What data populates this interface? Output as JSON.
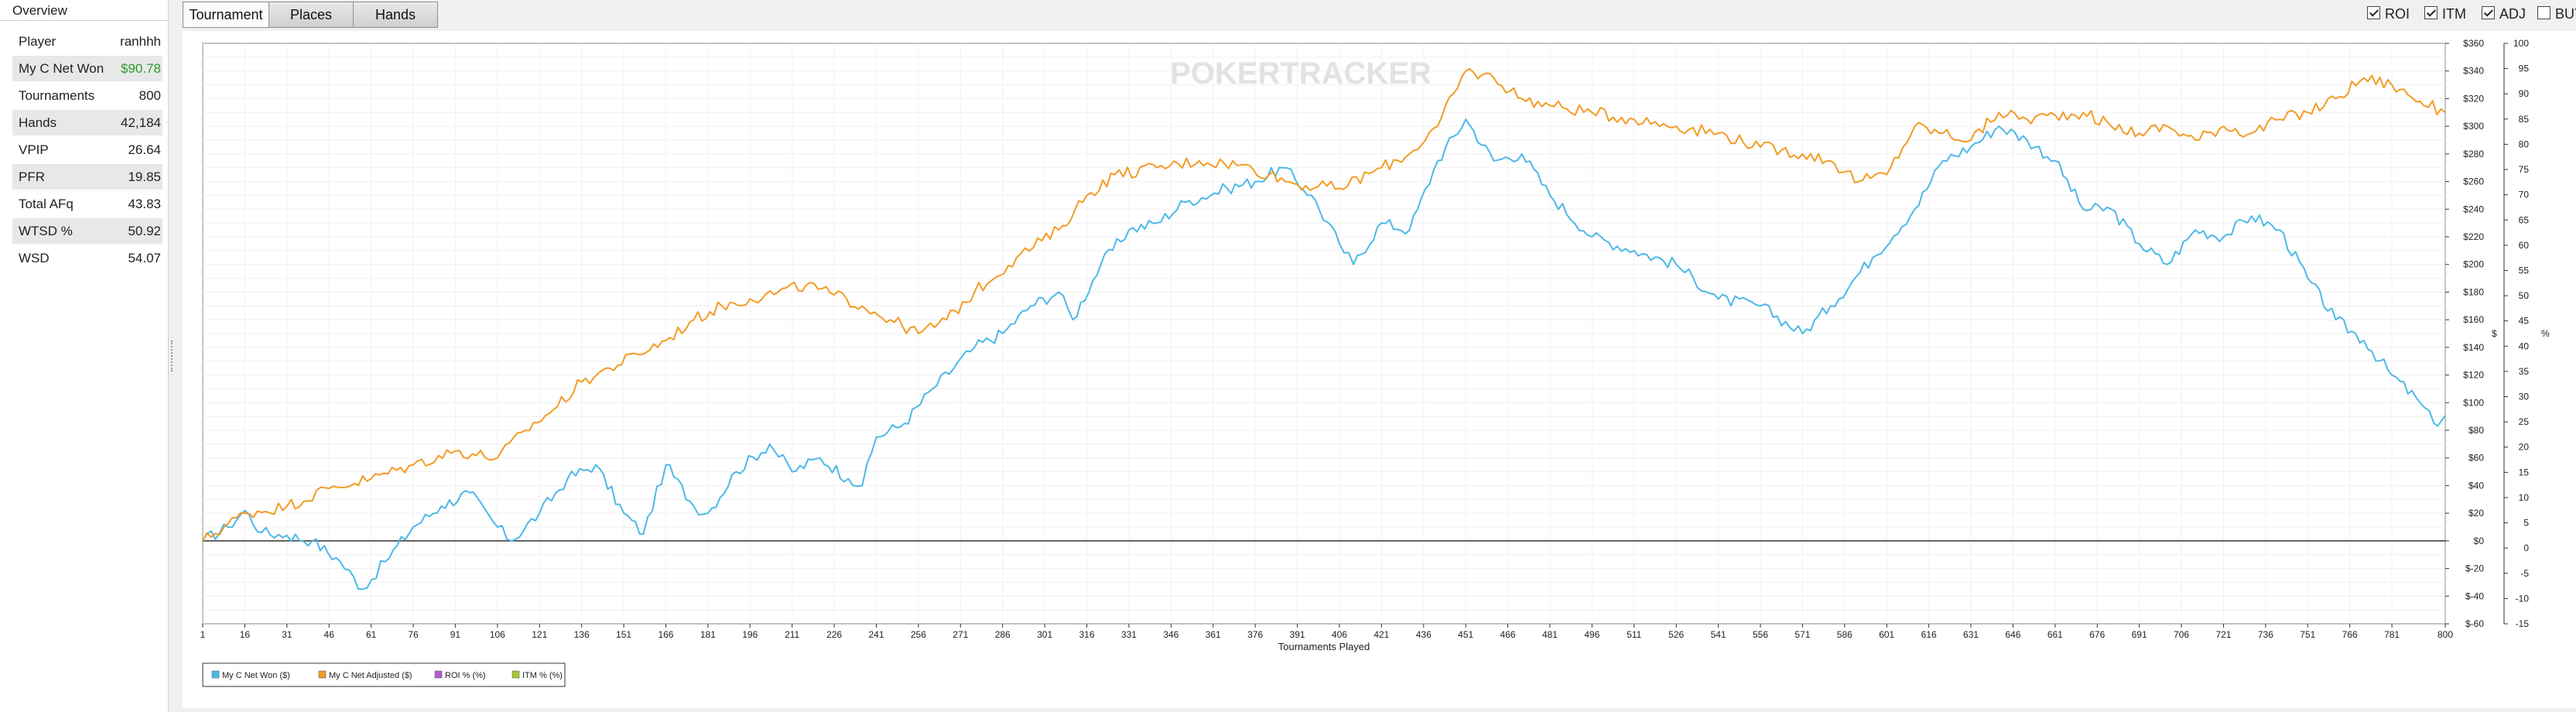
{
  "overview": {
    "title": "Overview",
    "stats": [
      {
        "label": "Player",
        "value": "ranhhh",
        "color": "#222222"
      },
      {
        "label": "My C Net Won",
        "value": "$90.78",
        "color": "#2e9a2e"
      },
      {
        "label": "Tournaments",
        "value": "800",
        "color": "#222222"
      },
      {
        "label": "Hands",
        "value": "42,184",
        "color": "#222222"
      },
      {
        "label": "VPIP",
        "value": "26.64",
        "color": "#222222"
      },
      {
        "label": "PFR",
        "value": "19.85",
        "color": "#222222"
      },
      {
        "label": "Total AFq",
        "value": "43.83",
        "color": "#222222"
      },
      {
        "label": "WTSD %",
        "value": "50.92",
        "color": "#222222"
      },
      {
        "label": "WSD",
        "value": "54.07",
        "color": "#222222"
      }
    ]
  },
  "tabs": [
    {
      "label": "Tournament",
      "active": true
    },
    {
      "label": "Places",
      "active": false
    },
    {
      "label": "Hands",
      "active": false
    }
  ],
  "toggles": [
    {
      "label": "ROI",
      "checked": true
    },
    {
      "label": "ITM",
      "checked": true
    },
    {
      "label": "ADJ",
      "checked": true
    },
    {
      "label": "BUY",
      "checked": false
    }
  ],
  "chart_data": {
    "type": "line",
    "watermark": "POKERTRACKER",
    "xlabel": "Tournaments Played",
    "ylabel": "$",
    "y2label": "%",
    "xlim": [
      1,
      800
    ],
    "ylim": [
      -60,
      360
    ],
    "y2lim": [
      -15,
      100
    ],
    "xticks": [
      1,
      16,
      31,
      46,
      61,
      76,
      91,
      106,
      121,
      136,
      151,
      166,
      181,
      196,
      211,
      226,
      241,
      256,
      271,
      286,
      301,
      316,
      331,
      346,
      361,
      376,
      391,
      406,
      421,
      436,
      451,
      466,
      481,
      496,
      511,
      526,
      541,
      556,
      571,
      586,
      601,
      616,
      631,
      646,
      661,
      676,
      691,
      706,
      721,
      736,
      751,
      766,
      781,
      800
    ],
    "yticks": [
      -60,
      -40,
      -20,
      0,
      20,
      40,
      60,
      80,
      100,
      120,
      140,
      160,
      180,
      200,
      220,
      240,
      260,
      280,
      300,
      320,
      340,
      360
    ],
    "ytick_labels": [
      "$-60",
      "$-40",
      "$-20",
      "$0",
      "$20",
      "$40",
      "$60",
      "$80",
      "$100",
      "$120",
      "$140",
      "$160",
      "$180",
      "$200",
      "$220",
      "$240",
      "$260",
      "$280",
      "$300",
      "$320",
      "$340",
      "$360"
    ],
    "y2ticks": [
      -15,
      -10,
      -5,
      0,
      5,
      10,
      15,
      20,
      25,
      30,
      35,
      40,
      45,
      50,
      55,
      60,
      65,
      70,
      75,
      80,
      85,
      90,
      95,
      100
    ],
    "grid": true,
    "legend_position": "bottom-left",
    "series": [
      {
        "name": "My C Net Won ($)",
        "color": "#4db8e8",
        "points": [
          [
            1,
            0
          ],
          [
            10,
            10
          ],
          [
            16,
            22
          ],
          [
            22,
            6
          ],
          [
            31,
            4
          ],
          [
            40,
            0
          ],
          [
            50,
            -15
          ],
          [
            58,
            -35
          ],
          [
            66,
            -15
          ],
          [
            76,
            10
          ],
          [
            86,
            25
          ],
          [
            96,
            35
          ],
          [
            106,
            10
          ],
          [
            111,
            0
          ],
          [
            121,
            20
          ],
          [
            131,
            45
          ],
          [
            141,
            55
          ],
          [
            151,
            20
          ],
          [
            158,
            5
          ],
          [
            166,
            55
          ],
          [
            176,
            25
          ],
          [
            181,
            20
          ],
          [
            191,
            50
          ],
          [
            203,
            70
          ],
          [
            211,
            50
          ],
          [
            221,
            60
          ],
          [
            231,
            45
          ],
          [
            236,
            40
          ],
          [
            241,
            75
          ],
          [
            251,
            85
          ],
          [
            261,
            110
          ],
          [
            276,
            140
          ],
          [
            286,
            150
          ],
          [
            296,
            170
          ],
          [
            306,
            180
          ],
          [
            311,
            160
          ],
          [
            321,
            200
          ],
          [
            331,
            225
          ],
          [
            341,
            230
          ],
          [
            351,
            245
          ],
          [
            366,
            255
          ],
          [
            376,
            260
          ],
          [
            386,
            270
          ],
          [
            396,
            250
          ],
          [
            406,
            215
          ],
          [
            411,
            200
          ],
          [
            421,
            230
          ],
          [
            431,
            225
          ],
          [
            441,
            275
          ],
          [
            451,
            305
          ],
          [
            461,
            275
          ],
          [
            471,
            280
          ],
          [
            481,
            250
          ],
          [
            496,
            220
          ],
          [
            511,
            210
          ],
          [
            526,
            200
          ],
          [
            541,
            175
          ],
          [
            556,
            170
          ],
          [
            571,
            150
          ],
          [
            581,
            170
          ],
          [
            596,
            205
          ],
          [
            611,
            240
          ],
          [
            621,
            275
          ],
          [
            631,
            285
          ],
          [
            641,
            300
          ],
          [
            651,
            290
          ],
          [
            661,
            275
          ],
          [
            671,
            240
          ],
          [
            681,
            240
          ],
          [
            691,
            215
          ],
          [
            701,
            200
          ],
          [
            711,
            225
          ],
          [
            721,
            220
          ],
          [
            731,
            235
          ],
          [
            741,
            225
          ],
          [
            751,
            190
          ],
          [
            761,
            160
          ],
          [
            771,
            145
          ],
          [
            781,
            120
          ],
          [
            791,
            100
          ],
          [
            796,
            85
          ],
          [
            800,
            90.78
          ]
        ]
      },
      {
        "name": "My C Net Adjusted ($)",
        "color": "#f39b25",
        "points": [
          [
            1,
            0
          ],
          [
            16,
            20
          ],
          [
            31,
            25
          ],
          [
            46,
            38
          ],
          [
            61,
            45
          ],
          [
            76,
            55
          ],
          [
            91,
            65
          ],
          [
            106,
            60
          ],
          [
            116,
            80
          ],
          [
            126,
            95
          ],
          [
            136,
            115
          ],
          [
            146,
            125
          ],
          [
            156,
            135
          ],
          [
            166,
            145
          ],
          [
            176,
            160
          ],
          [
            186,
            170
          ],
          [
            196,
            175
          ],
          [
            206,
            180
          ],
          [
            216,
            185
          ],
          [
            226,
            178
          ],
          [
            236,
            170
          ],
          [
            246,
            160
          ],
          [
            256,
            150
          ],
          [
            266,
            160
          ],
          [
            276,
            180
          ],
          [
            291,
            205
          ],
          [
            306,
            225
          ],
          [
            316,
            250
          ],
          [
            326,
            265
          ],
          [
            341,
            270
          ],
          [
            356,
            275
          ],
          [
            371,
            272
          ],
          [
            381,
            265
          ],
          [
            391,
            258
          ],
          [
            406,
            255
          ],
          [
            421,
            270
          ],
          [
            431,
            280
          ],
          [
            441,
            300
          ],
          [
            451,
            340
          ],
          [
            461,
            335
          ],
          [
            471,
            320
          ],
          [
            481,
            315
          ],
          [
            496,
            310
          ],
          [
            511,
            305
          ],
          [
            526,
            300
          ],
          [
            541,
            295
          ],
          [
            556,
            285
          ],
          [
            571,
            280
          ],
          [
            581,
            275
          ],
          [
            591,
            260
          ],
          [
            601,
            265
          ],
          [
            611,
            300
          ],
          [
            621,
            295
          ],
          [
            631,
            290
          ],
          [
            641,
            310
          ],
          [
            651,
            305
          ],
          [
            661,
            308
          ],
          [
            671,
            310
          ],
          [
            681,
            300
          ],
          [
            691,
            295
          ],
          [
            701,
            300
          ],
          [
            711,
            290
          ],
          [
            721,
            300
          ],
          [
            731,
            295
          ],
          [
            741,
            305
          ],
          [
            751,
            310
          ],
          [
            761,
            320
          ],
          [
            771,
            335
          ],
          [
            781,
            330
          ],
          [
            791,
            318
          ],
          [
            800,
            310
          ]
        ]
      },
      {
        "name": "ROI % (%)",
        "color": "#b05fd0",
        "points": []
      },
      {
        "name": "ITM % (%)",
        "color": "#a8c83a",
        "points": []
      }
    ]
  }
}
